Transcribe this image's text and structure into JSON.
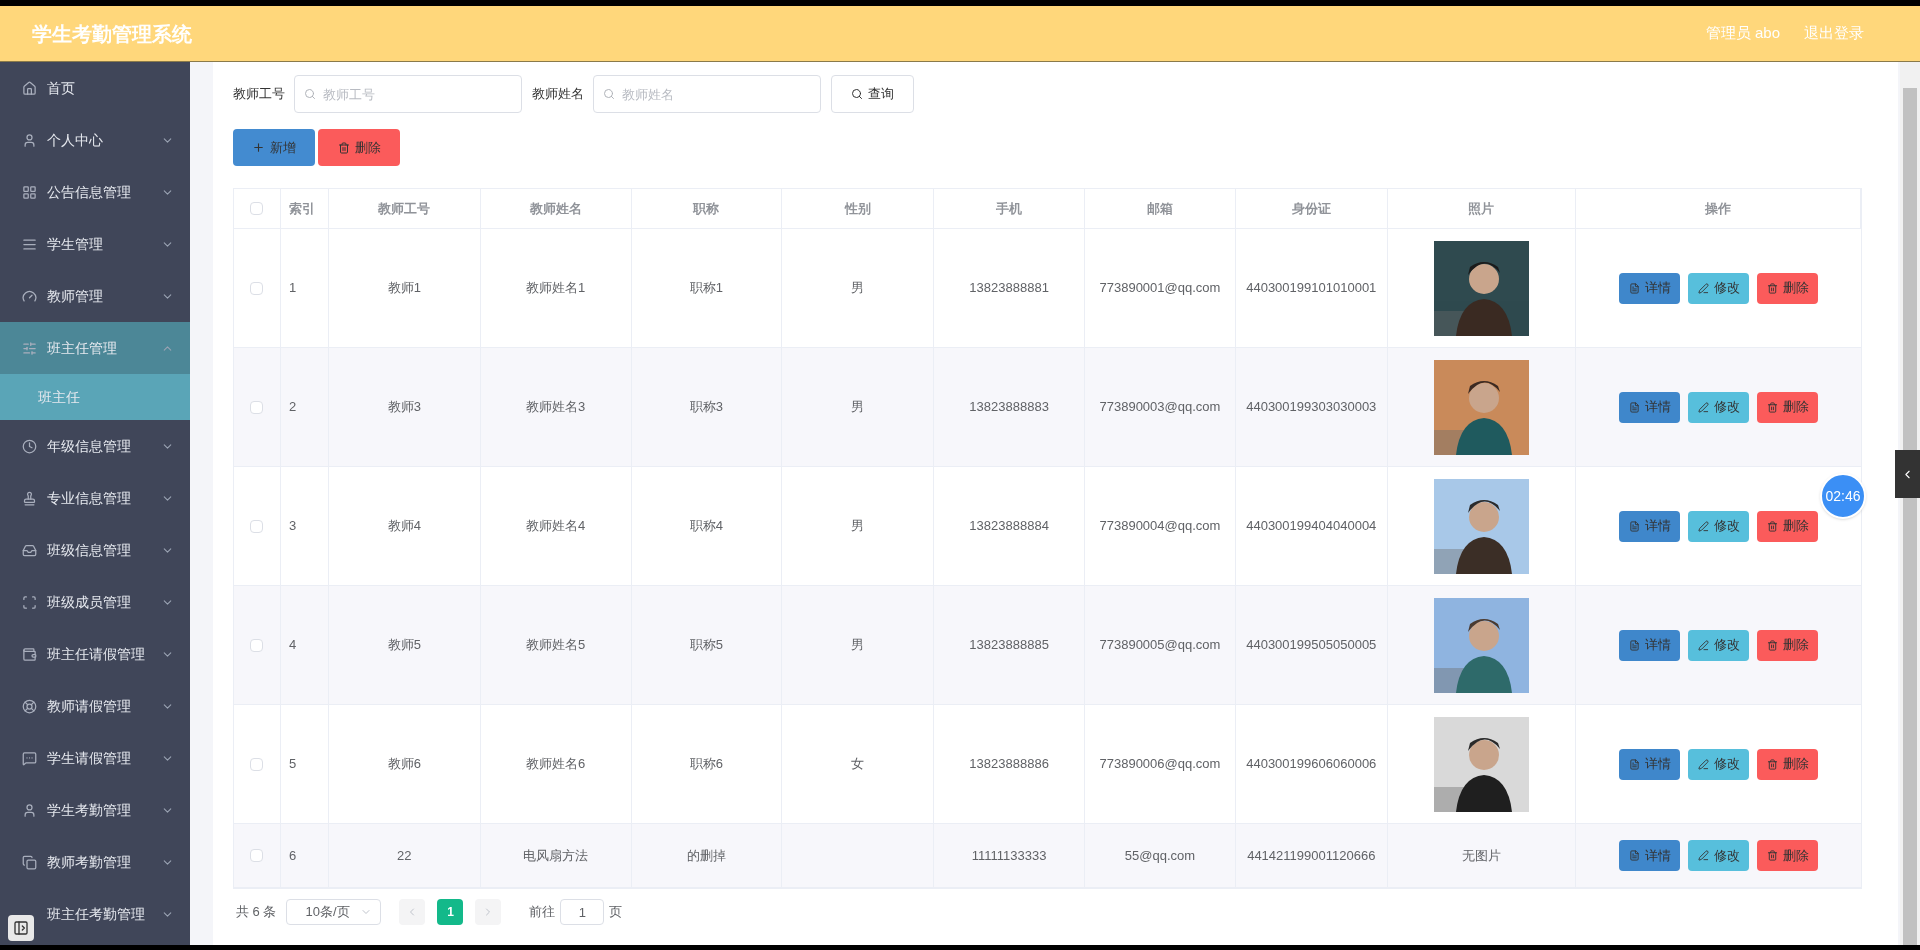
{
  "header": {
    "title": "学生考勤管理系统",
    "user": "管理员 abo",
    "logout": "退出登录"
  },
  "sidebar": {
    "items": [
      {
        "label": "首页",
        "kind": "link"
      },
      {
        "label": "个人中心",
        "kind": "menu",
        "expanded": false
      },
      {
        "label": "公告信息管理",
        "kind": "menu",
        "expanded": false
      },
      {
        "label": "学生管理",
        "kind": "menu",
        "expanded": false
      },
      {
        "label": "教师管理",
        "kind": "menu",
        "expanded": false
      },
      {
        "label": "班主任管理",
        "kind": "menu",
        "expanded": true,
        "children": [
          {
            "label": "班主任",
            "selected": true
          }
        ]
      },
      {
        "label": "年级信息管理",
        "kind": "menu",
        "expanded": false
      },
      {
        "label": "专业信息管理",
        "kind": "menu",
        "expanded": false
      },
      {
        "label": "班级信息管理",
        "kind": "menu",
        "expanded": false
      },
      {
        "label": "班级成员管理",
        "kind": "menu",
        "expanded": false
      },
      {
        "label": "班主任请假管理",
        "kind": "menu",
        "expanded": false
      },
      {
        "label": "教师请假管理",
        "kind": "menu",
        "expanded": false
      },
      {
        "label": "学生请假管理",
        "kind": "menu",
        "expanded": false
      },
      {
        "label": "学生考勤管理",
        "kind": "menu",
        "expanded": false
      },
      {
        "label": "教师考勤管理",
        "kind": "menu",
        "expanded": false
      },
      {
        "label": "班主任考勤管理",
        "kind": "menu",
        "expanded": false
      }
    ]
  },
  "search": {
    "fields": [
      {
        "label": "教师工号",
        "placeholder": "教师工号"
      },
      {
        "label": "教师姓名",
        "placeholder": "教师姓名"
      }
    ],
    "button": "查询"
  },
  "actions": [
    {
      "label": "新增",
      "kind": "add"
    },
    {
      "label": "删除",
      "kind": "delete"
    }
  ],
  "table": {
    "select_all_checked": false,
    "columns": [
      "索引",
      "教师工号",
      "教师姓名",
      "职称",
      "性别",
      "手机",
      "邮箱",
      "身份证",
      "照片",
      "操作"
    ],
    "rows": [
      {
        "checked": false,
        "cells": [
          "1",
          "教师1",
          "教师姓名1",
          "职称1",
          "男",
          "13823888881",
          "773890001@qq.com",
          "440300199101010001"
        ],
        "actions": [
          "详情",
          "修改",
          "删除"
        ]
      },
      {
        "checked": false,
        "cells": [
          "2",
          "教师3",
          "教师姓名3",
          "职称3",
          "男",
          "13823888883",
          "773890003@qq.com",
          "440300199303030003"
        ],
        "actions": [
          "详情",
          "修改",
          "删除"
        ]
      },
      {
        "checked": false,
        "cells": [
          "3",
          "教师4",
          "教师姓名4",
          "职称4",
          "男",
          "13823888884",
          "773890004@qq.com",
          "440300199404040004"
        ],
        "actions": [
          "详情",
          "修改",
          "删除"
        ]
      },
      {
        "checked": false,
        "cells": [
          "4",
          "教师5",
          "教师姓名5",
          "职称5",
          "男",
          "13823888885",
          "773890005@qq.com",
          "440300199505050005"
        ],
        "actions": [
          "详情",
          "修改",
          "删除"
        ]
      },
      {
        "checked": false,
        "cells": [
          "5",
          "教师6",
          "教师姓名6",
          "职称6",
          "女",
          "13823888886",
          "773890006@qq.com",
          "440300199606060006"
        ],
        "actions": [
          "详情",
          "修改",
          "删除"
        ]
      },
      {
        "checked": false,
        "cells": [
          "6",
          "22",
          "电风扇方法",
          "的删掉",
          "",
          "11111133333",
          "55@qq.com",
          "441421199001120666"
        ],
        "photo": {
          "kind": "text",
          "text": "无图片"
        },
        "actions": [
          "详情",
          "修改",
          "删除"
        ]
      }
    ]
  },
  "pagination": {
    "total": "共 6 条",
    "page_size": "10条/页",
    "pages": [
      {
        "label": "1",
        "selected": true
      }
    ],
    "goto_label": "前往",
    "goto_value": "1",
    "goto_suffix": "页"
  },
  "timer": "02:46"
}
